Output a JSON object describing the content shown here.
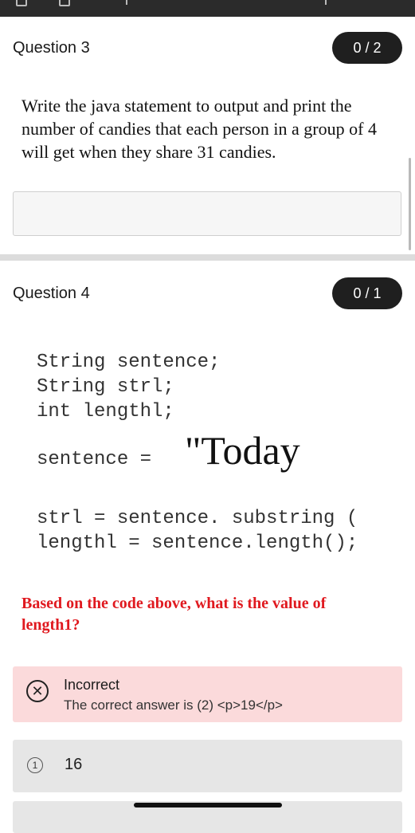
{
  "question3": {
    "title": "Question 3",
    "score": "0 / 2",
    "text": "Write the java statement to output and print the number of candies that each person in a group of 4 will get when they share 31 candies."
  },
  "question4": {
    "title": "Question 4",
    "score": "0 / 1",
    "code": {
      "line1": "String sentence;",
      "line2": "String strl;",
      "line3": "int lengthl;",
      "sentence_lhs": "sentence =",
      "sentence_value": "\"Today",
      "line5": "strl = sentence. substring (",
      "line6": "lengthl = sentence.length();"
    },
    "prompt": "Based on the code above, what is the value of length1?",
    "feedback": {
      "status": "Incorrect",
      "message": "The correct answer is (2) <p>19</p>"
    },
    "options": [
      {
        "number": "1",
        "text": "16"
      }
    ]
  }
}
